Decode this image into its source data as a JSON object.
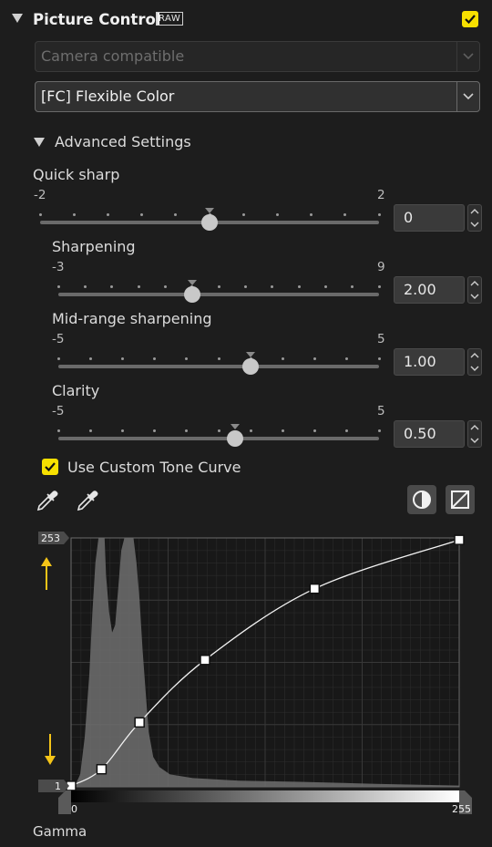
{
  "header": {
    "title": "Picture Control",
    "raw_badge": "RAW",
    "enabled": true
  },
  "camera_select": {
    "value": "Camera compatible",
    "disabled": true
  },
  "picture_select": {
    "value": "[FC] Flexible Color"
  },
  "advanced": {
    "title": "Advanced Settings",
    "sliders": [
      {
        "label": "Quick sharp",
        "min": -2,
        "max": 2,
        "min_label": "-2",
        "max_label": "2",
        "value": 0,
        "value_text": "0",
        "default": 0,
        "ticks": 11
      },
      {
        "label": "Sharpening",
        "min": -3,
        "max": 9,
        "min_label": "-3",
        "max_label": "9",
        "value": 2,
        "value_text": "2.00",
        "default": 2,
        "ticks": 13
      },
      {
        "label": "Mid-range sharpening",
        "min": -5,
        "max": 5,
        "min_label": "-5",
        "max_label": "5",
        "value": 1,
        "value_text": "1.00",
        "default": 1,
        "ticks": 11
      },
      {
        "label": "Clarity",
        "min": -5,
        "max": 5,
        "min_label": "-5",
        "max_label": "5",
        "value": 0.5,
        "value_text": "0.50",
        "default": 0.5,
        "ticks": 11
      }
    ]
  },
  "tone_curve": {
    "checkbox_label": "Use Custom Tone Curve",
    "checked": true,
    "output_high": "253",
    "output_low": "1",
    "input_low": "0",
    "input_high": "255",
    "footer_label": "Gamma",
    "points": [
      [
        0,
        1
      ],
      [
        20,
        18
      ],
      [
        45,
        66
      ],
      [
        88,
        130
      ],
      [
        160,
        203
      ],
      [
        255,
        253
      ]
    ],
    "accent": "#f5c518"
  },
  "icons": {
    "header_toggle": "triangle-down-icon",
    "black_point": "eyedropper-black-icon",
    "white_point": "eyedropper-white-icon",
    "contrast": "contrast-icon",
    "reset_curve": "linear-curve-icon"
  }
}
